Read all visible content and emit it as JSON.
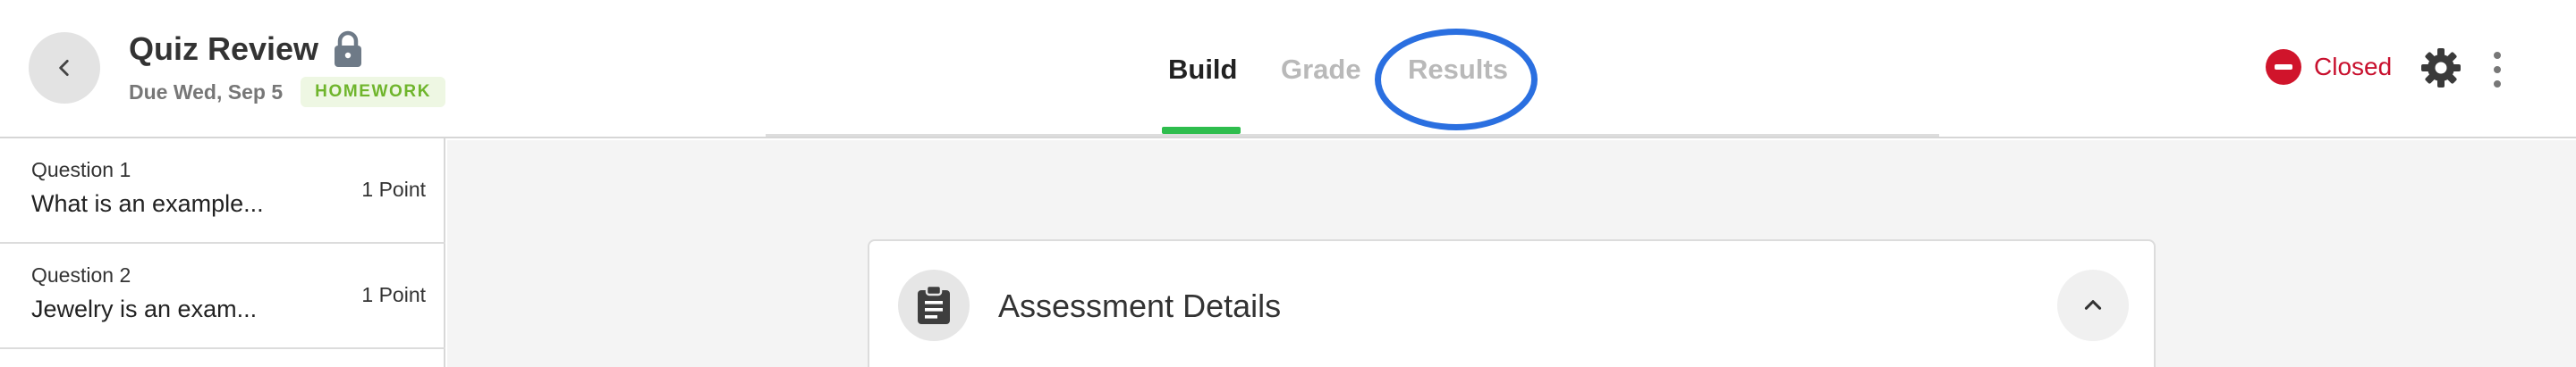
{
  "header": {
    "title": "Quiz Review",
    "due": "Due Wed, Sep 5",
    "badge": "HOMEWORK",
    "status_label": "Closed",
    "icons": {
      "back": "chevron-left-icon",
      "lock": "lock-icon",
      "status": "no-entry-icon",
      "settings": "gear-icon",
      "more": "kebab-menu-icon"
    }
  },
  "tabs": [
    {
      "label": "Build",
      "active": true
    },
    {
      "label": "Grade",
      "active": false
    },
    {
      "label": "Results",
      "active": false
    }
  ],
  "sidebar": {
    "questions": [
      {
        "number": "Question 1",
        "text": "What is an example...",
        "points": "1 Point"
      },
      {
        "number": "Question 2",
        "text": "Jewelry is an exam...",
        "points": "1 Point"
      }
    ]
  },
  "main": {
    "card_title": "Assessment Details",
    "icons": {
      "card": "clipboard-icon",
      "collapse": "chevron-up-icon"
    }
  },
  "colors": {
    "accent_green": "#2ebd4d",
    "status_red": "#d0142b",
    "badge_green": "#6fb52c",
    "highlight_blue": "#2a6fe0"
  }
}
